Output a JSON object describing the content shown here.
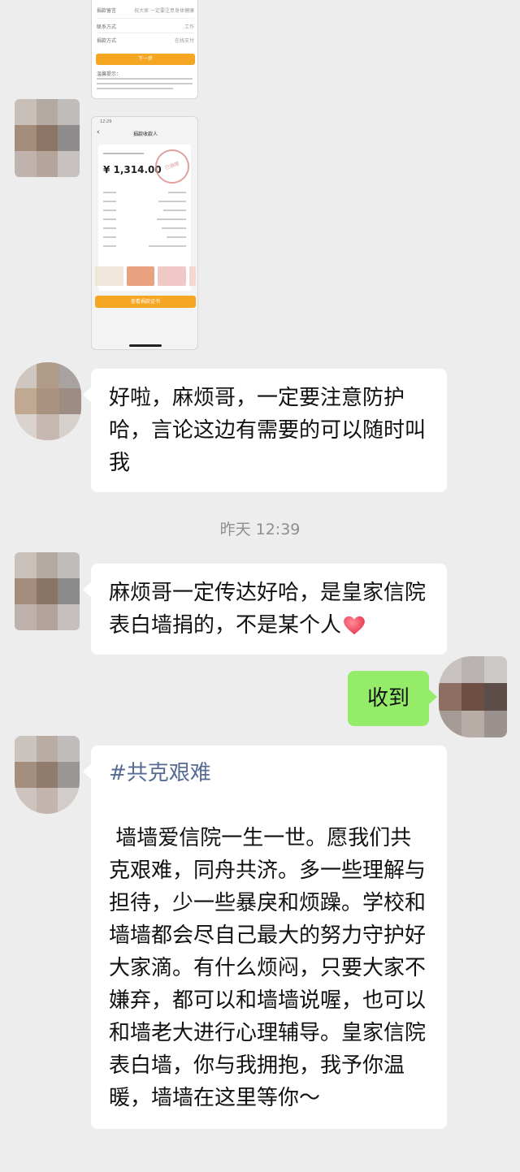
{
  "screenshot1": {
    "form_rows": [
      [
        "捐款留言",
        "祝大家 一定要注意身体健康"
      ],
      [
        "联系方式",
        "",
        "工作"
      ],
      [
        "捐款方式",
        "",
        "在线支付"
      ]
    ],
    "next_button": "下一步",
    "notice_title": "温馨提示："
  },
  "screenshot2": {
    "time": "12:29",
    "header_title": "捐款收款人",
    "amount": "¥ 1,314.00",
    "stamp_text": "已捐赠",
    "confirm_button": "查看捐款证书"
  },
  "messages": [
    {
      "id": "m1",
      "side": "left",
      "text": "好啦，麻烦哥，一定要注意防护哈，言论这边有需要的可以随时叫我"
    },
    {
      "id": "m2",
      "side": "left",
      "text": "麻烦哥一定传达好哈，是皇家信院表白墙捐的，不是某个人",
      "emoji": "red-heart"
    },
    {
      "id": "m3",
      "side": "right",
      "text": "收到"
    },
    {
      "id": "m4",
      "side": "left",
      "hashtag": "#共克艰难",
      "text": " 墙墙爱信院一生一世。愿我们共克艰难，同舟共济。多一些理解与担待，少一些暴戾和烦躁。学校和墙墙都会尽自己最大的努力守护好大家滴。有什么烦闷，只要大家不嫌弃，都可以和墙墙说喔，也可以和墙老大进行心理辅导。皇家信院表白墙，你与我拥抱，我予你温暖，墙墙在这里等你～"
    }
  ],
  "timestamp": "昨天 12:39",
  "colors": {
    "background": "#ededed",
    "bubble_left": "#ffffff",
    "bubble_right": "#95ec69",
    "hashtag": "#576b95",
    "button_orange": "#f5a623"
  }
}
